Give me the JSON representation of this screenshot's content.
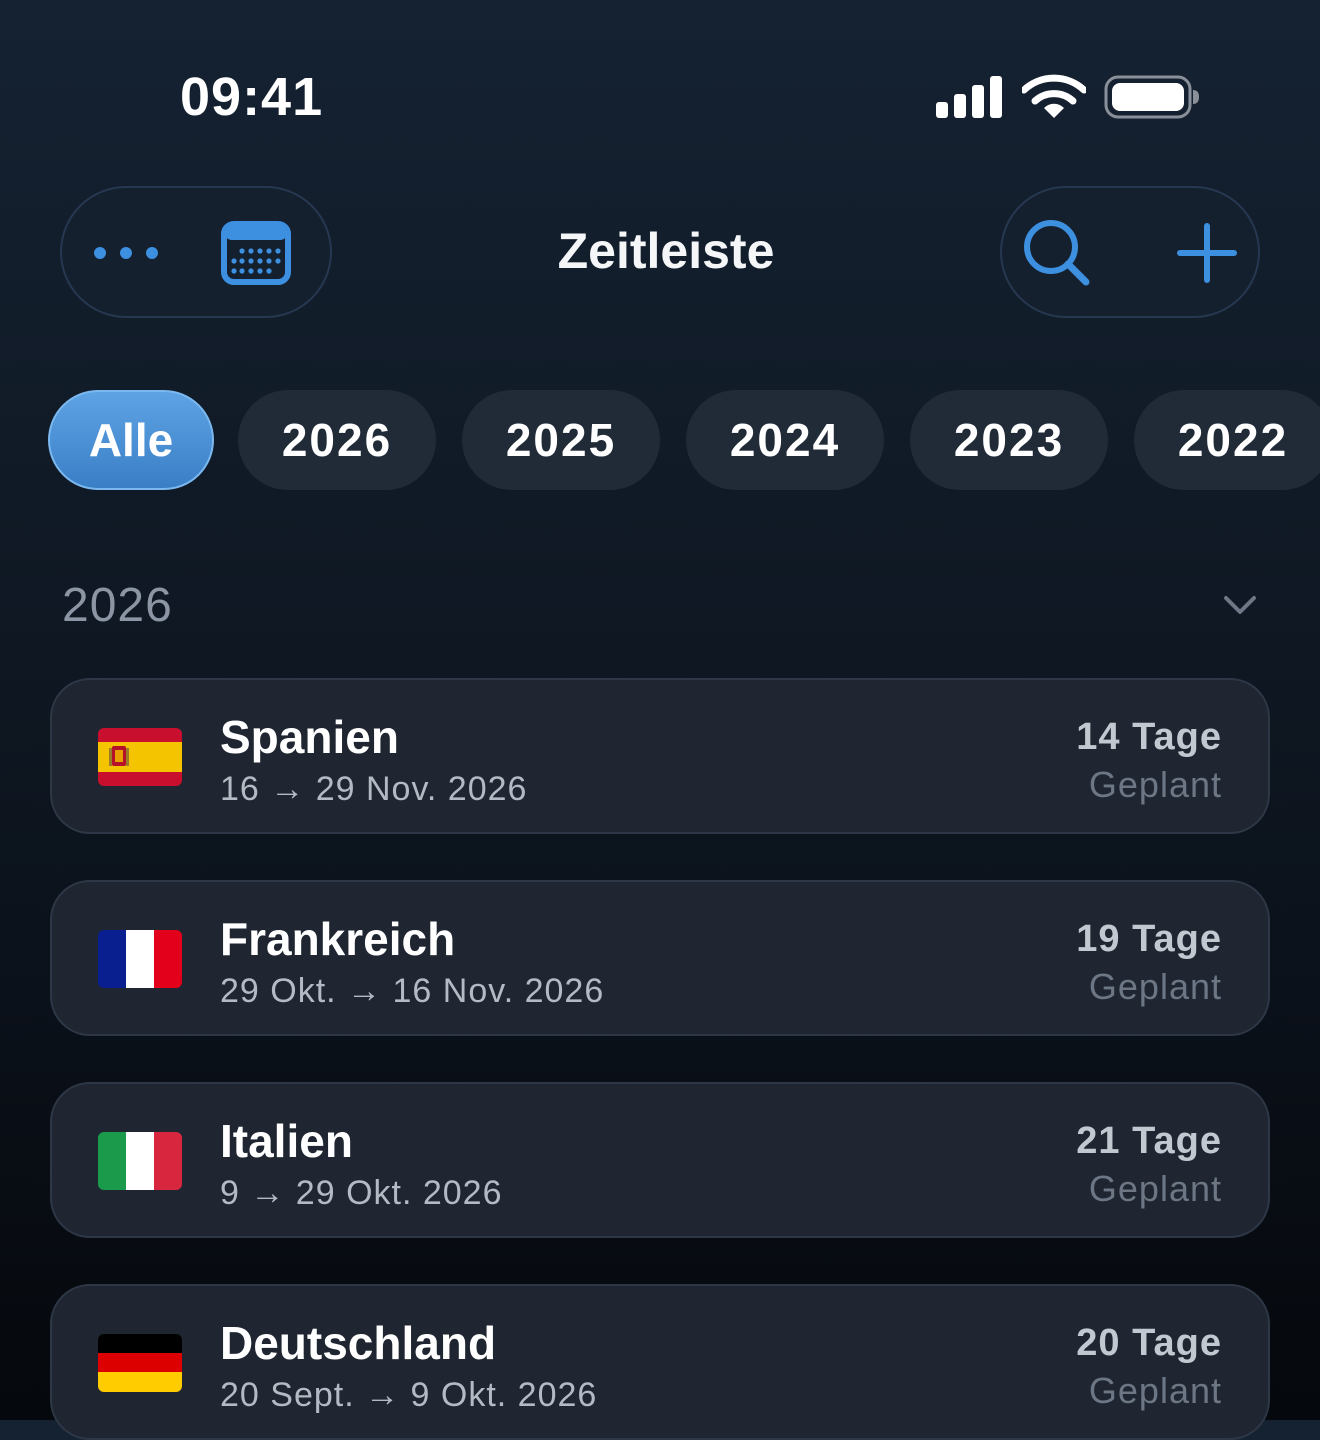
{
  "status_bar": {
    "time": "09:41",
    "icons": [
      "cellular-signal-icon",
      "wifi-icon",
      "battery-icon"
    ]
  },
  "header": {
    "title": "Zeitleiste",
    "left_actions": [
      {
        "name": "more-button",
        "icon": "ellipsis-icon"
      },
      {
        "name": "calendar-button",
        "icon": "calendar-icon"
      }
    ],
    "right_actions": [
      {
        "name": "search-button",
        "icon": "magnifier-icon"
      },
      {
        "name": "add-button",
        "icon": "plus-icon"
      }
    ],
    "accent_color": "#3d8fe0"
  },
  "filters": {
    "selected": "Alle",
    "chips": [
      "Alle",
      "2026",
      "2025",
      "2024",
      "2023",
      "2022"
    ]
  },
  "section": {
    "year": "2026",
    "toggle_icon": "chevron-down-icon"
  },
  "trips": [
    {
      "country": "Spanien",
      "dates": "16 → 29 Nov. 2026",
      "days": "14 Tage",
      "status": "Geplant",
      "flag": "spain-flag"
    },
    {
      "country": "Frankreich",
      "dates": "29 Okt. → 16 Nov. 2026",
      "days": "19 Tage",
      "status": "Geplant",
      "flag": "france-flag"
    },
    {
      "country": "Italien",
      "dates": "9 → 29 Okt. 2026",
      "days": "21 Tage",
      "status": "Geplant",
      "flag": "italy-flag"
    },
    {
      "country": "Deutschland",
      "dates": "20 Sept. → 9 Okt. 2026",
      "days": "20 Tage",
      "status": "Geplant",
      "flag": "germany-flag"
    }
  ]
}
